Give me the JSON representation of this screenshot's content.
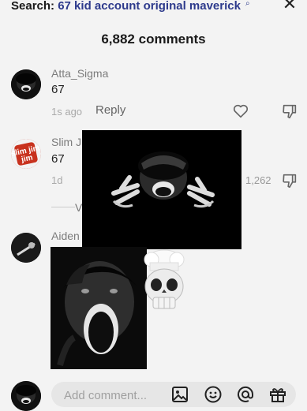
{
  "search": {
    "label": "Search:",
    "query": "67 kid account original maverick",
    "close_icon": "close-icon"
  },
  "header": {
    "comments_count": "6,882 comments"
  },
  "comments": [
    {
      "username": "Atta_Sigma",
      "text": "67",
      "time": "1s ago",
      "reply": "Reply"
    },
    {
      "username": "Slim J",
      "text": "67",
      "time": "1d",
      "likes": "1,262"
    },
    {
      "username": "Aiden",
      "view_prefix": "V"
    }
  ],
  "avatar_badges": {
    "slim_jim": "slim jim"
  },
  "composer": {
    "placeholder": "Add comment..."
  },
  "icons": [
    "heart-icon",
    "dislike-icon",
    "image-icon",
    "emoji-icon",
    "mention-icon",
    "gift-icon"
  ]
}
